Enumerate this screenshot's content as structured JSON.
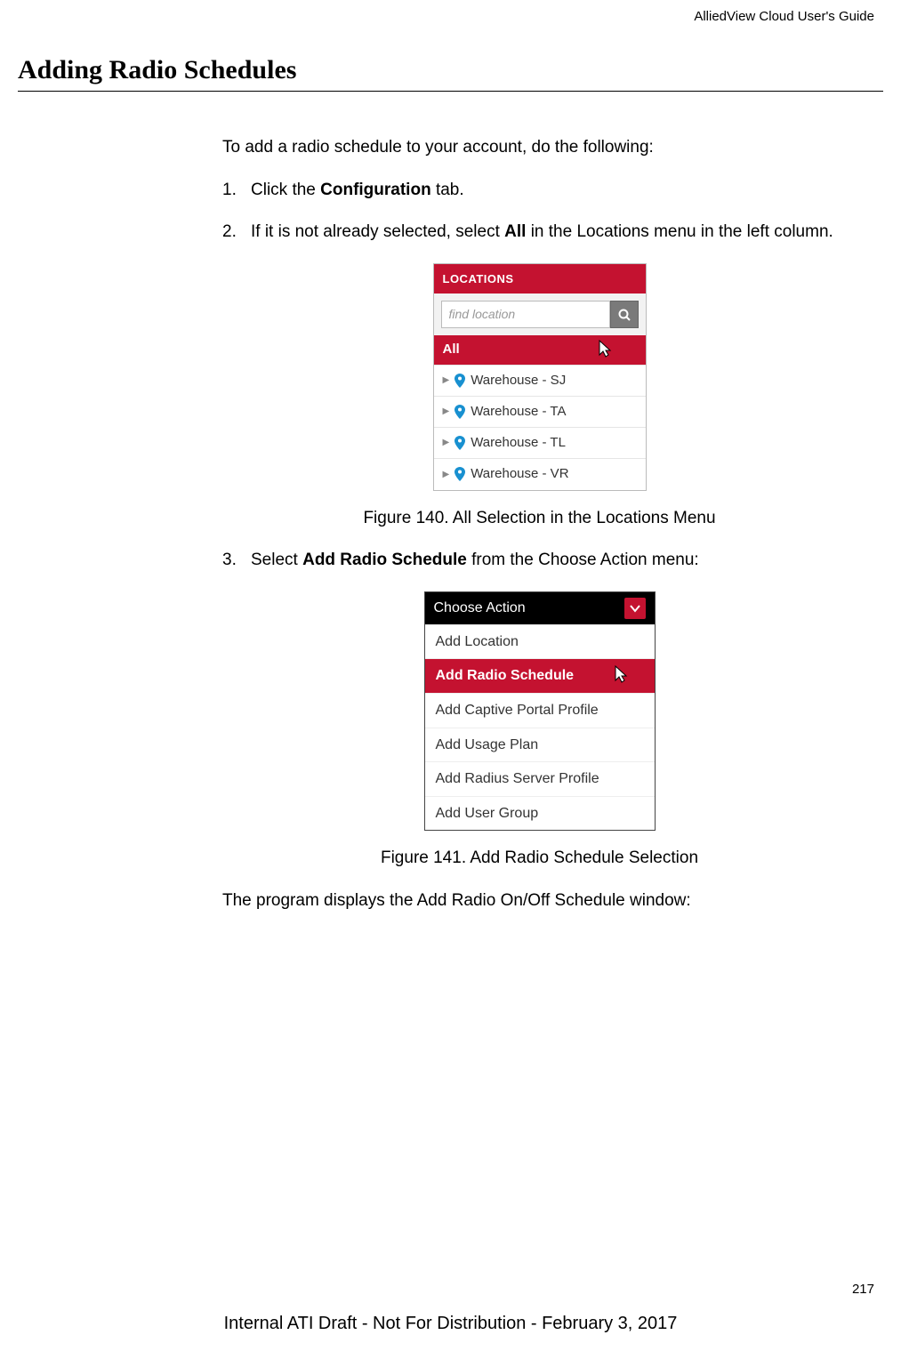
{
  "header": {
    "doc_title": "AlliedView Cloud User's Guide"
  },
  "section": {
    "title": "Adding Radio Schedules"
  },
  "body": {
    "intro": "To add a radio schedule to your account, do the following:",
    "step1_num": "1.",
    "step1_a": "Click the ",
    "step1_bold": "Configuration",
    "step1_b": " tab.",
    "step2_num": "2.",
    "step2_a": "If it is not already selected, select ",
    "step2_bold": "All",
    "step2_b": " in the Locations menu in the left column.",
    "step3_num": "3.",
    "step3_a": "Select ",
    "step3_bold": "Add Radio Schedule",
    "step3_b": " from the Choose Action menu:",
    "para_after": "The program displays the Add Radio On/Off Schedule window:"
  },
  "figures": {
    "f140": "Figure 140. All Selection in the Locations Menu",
    "f141": "Figure 141. Add Radio Schedule Selection"
  },
  "locations_panel": {
    "header": "LOCATIONS",
    "search_placeholder": "find location",
    "all": "All",
    "items": [
      "Warehouse - SJ",
      "Warehouse - TA",
      "Warehouse - TL",
      "Warehouse - VR"
    ]
  },
  "action_panel": {
    "header": "Choose Action",
    "items": [
      "Add Location",
      "Add Radio Schedule",
      "Add Captive Portal Profile",
      "Add Usage Plan",
      "Add Radius Server Profile",
      "Add User Group"
    ]
  },
  "footer": {
    "page_num": "217",
    "draft": "Internal ATI Draft - Not For Distribution - February 3, 2017"
  }
}
